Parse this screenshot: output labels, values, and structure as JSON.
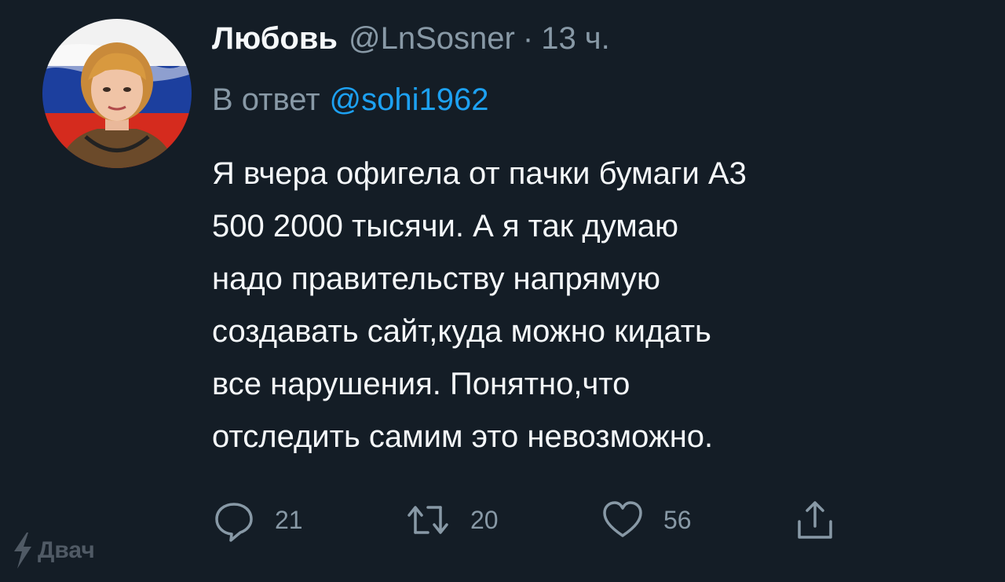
{
  "tweet": {
    "author_name": "Любовь",
    "handle": "@LnSosner",
    "separator": "·",
    "time": "13 ч.",
    "reply_prefix": "В ответ",
    "reply_mention": "@sohi1962",
    "text_lines": [
      "Я вчера офигела от пачки бумаги А3",
      "500 2000 тысячи. А я так думаю",
      "надо правительству напрямую",
      "создавать сайт,куда можно кидать",
      "все нарушения. Понятно,что",
      "отследить самим это невозможно."
    ]
  },
  "actions": {
    "reply_icon": "reply-bubble-icon",
    "reply_count": "21",
    "retweet_icon": "retweet-icon",
    "retweet_count": "20",
    "like_icon": "heart-icon",
    "like_count": "56",
    "share_icon": "share-icon"
  },
  "avatar": {
    "icon": "avatar-photo-flag-background",
    "flag_colors": [
      "#ffffff",
      "#1c3f9e",
      "#d52b1e"
    ]
  },
  "watermark": {
    "icon": "lightning-icon",
    "label": "Двач"
  },
  "colors": {
    "background": "#141d26",
    "text": "#f5f8fa",
    "secondary": "#8899a6",
    "link": "#1da1f2"
  }
}
